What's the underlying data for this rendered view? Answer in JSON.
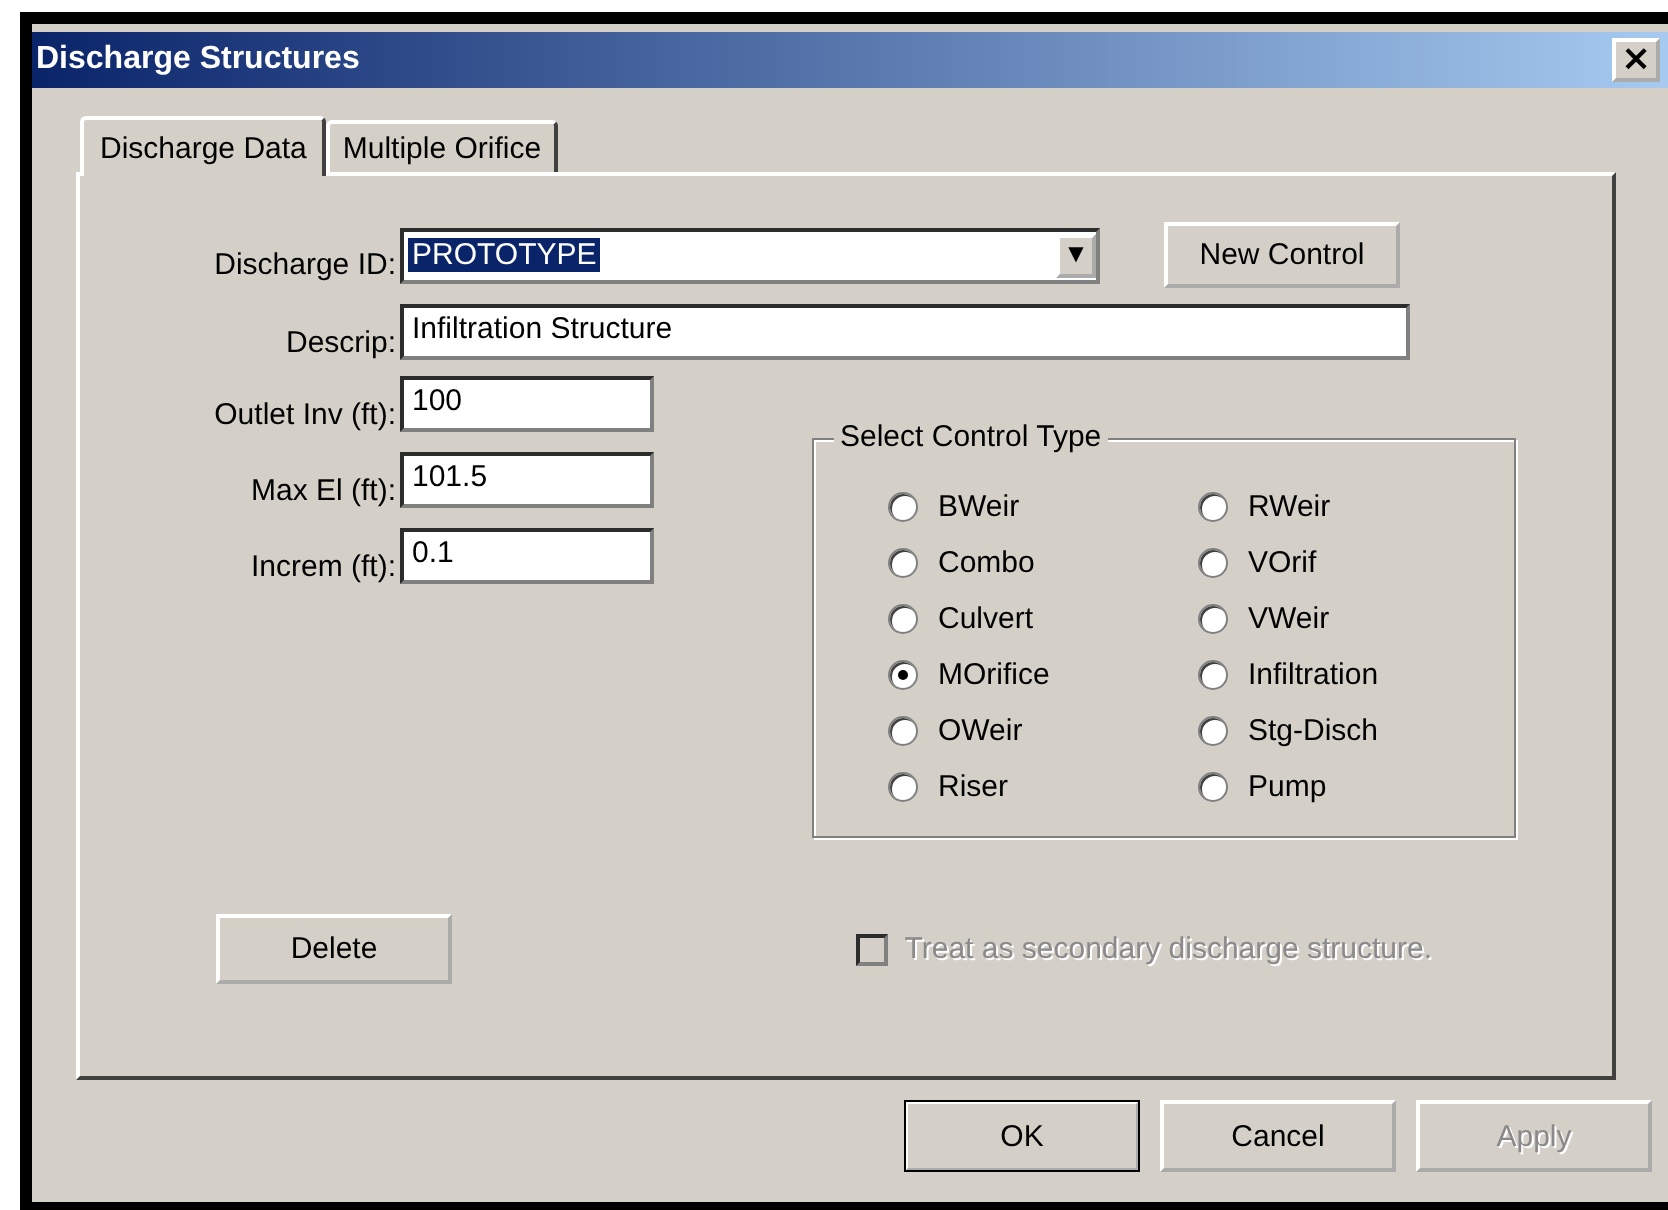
{
  "window": {
    "title": "Discharge Structures",
    "close": "×"
  },
  "tabs": [
    {
      "label": "Discharge Data",
      "selected": true
    },
    {
      "label": "Multiple Orifice",
      "selected": false
    }
  ],
  "discharge_id": {
    "label": "Discharge ID:",
    "value": "PROTOTYPE",
    "dropdown": "▼"
  },
  "new_control_button": "New Control",
  "descrip": {
    "label": "Descrip:",
    "value": "Infiltration Structure"
  },
  "fields": [
    {
      "label": "Outlet Inv (ft):",
      "value": "100"
    },
    {
      "label": "Max El (ft):",
      "value": "101.5"
    },
    {
      "label": "Increm (ft):",
      "value": "0.1"
    }
  ],
  "control_type": {
    "title": "Select Control Type",
    "options": [
      {
        "label": "BWeir",
        "selected": false
      },
      {
        "label": "RWeir",
        "selected": false
      },
      {
        "label": "Combo",
        "selected": false
      },
      {
        "label": "VOrif",
        "selected": false
      },
      {
        "label": "Culvert",
        "selected": false
      },
      {
        "label": "VWeir",
        "selected": false
      },
      {
        "label": "MOrifice",
        "selected": true
      },
      {
        "label": "Infiltration",
        "selected": false
      },
      {
        "label": "OWeir",
        "selected": false
      },
      {
        "label": "Stg-Disch",
        "selected": false
      },
      {
        "label": "Riser",
        "selected": false
      },
      {
        "label": "Pump",
        "selected": false
      }
    ]
  },
  "delete_button": "Delete",
  "secondary": {
    "label": "Treat as secondary discharge structure.",
    "checked": false,
    "disabled": true
  },
  "buttons": [
    {
      "label": "OK",
      "disabled": false,
      "default": true
    },
    {
      "label": "Cancel",
      "disabled": false,
      "default": false
    },
    {
      "label": "Apply",
      "disabled": true,
      "default": false
    }
  ]
}
